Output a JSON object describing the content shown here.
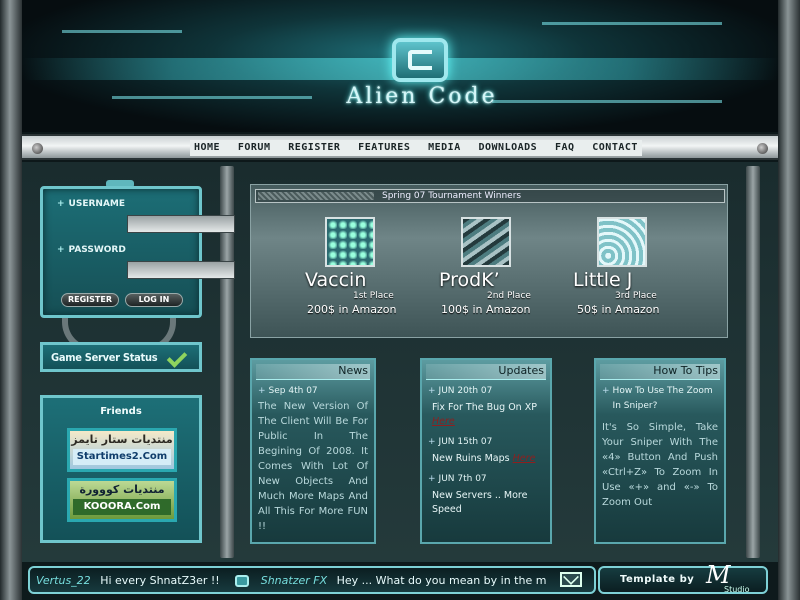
{
  "header": {
    "logo_text": "Alien Code"
  },
  "nav": {
    "items": [
      "HOME",
      "FORUM",
      "REGISTER",
      "FEATURES",
      "MEDIA",
      "DOWNLOADS",
      "FAQ",
      "CONTACT"
    ]
  },
  "login": {
    "username_label": "USERNAME",
    "password_label": "PASSWORD",
    "username_value": "",
    "password_value": "",
    "register_label": "REGISTER",
    "login_label": "LOG IN"
  },
  "status": {
    "label": "Game Server Status"
  },
  "friends": {
    "title": "Friends",
    "banners": [
      {
        "arabic": "منتديات ستار تايمز",
        "latin": "Startimes2.Com"
      },
      {
        "arabic": "منتديات كووورة",
        "latin": "KOOORA.Com"
      }
    ]
  },
  "winners": {
    "title": "Spring  07 Tournament Winners",
    "list": [
      {
        "name": "Vaccin",
        "place": "1st Place",
        "prize": "200$ in Amazon"
      },
      {
        "name": "ProdK’",
        "place": "2nd Place",
        "prize": "100$ in Amazon"
      },
      {
        "name": "Little J",
        "place": "3rd Place",
        "prize": "50$ in Amazon"
      }
    ]
  },
  "news": {
    "title": "News",
    "date": "Sep 4th 07",
    "body": "The New Version Of The Client Will Be For Public In The Begining Of 2008. It Comes With Lot Of New Objects And Much More Maps And All This For More FUN !!"
  },
  "updates": {
    "title": "Updates",
    "entries": [
      {
        "date": "JUN 20th 07",
        "text": "Fix For The Bug On XP",
        "link": "Here"
      },
      {
        "date": "JUN 15th 07",
        "text": "New Ruins Maps",
        "link": "Here"
      },
      {
        "date": "JUN 7th 07",
        "text": "New Servers .. More Speed",
        "link": ""
      }
    ]
  },
  "tips": {
    "title": "How To Tips",
    "question": "How To Use The Zoom In Sniper?",
    "body": "It's So Simple, Take Your Sniper With The «4» Button And Push «Ctrl+Z» To Zoom In Use «+» and «-» To Zoom Out"
  },
  "shoutbox": {
    "messages": [
      {
        "user": "Vertus_22",
        "text": "Hi every ShnatZ3er !!"
      },
      {
        "user": "Shnatzer FX",
        "text": "Hey ... What do you mean by in the m"
      }
    ]
  },
  "footer": {
    "template_label": "Template by",
    "signature_sub": "Studio"
  },
  "colors": {
    "accent": "#6fc6cc",
    "panel": "#1d6f77",
    "background": "#122224"
  }
}
